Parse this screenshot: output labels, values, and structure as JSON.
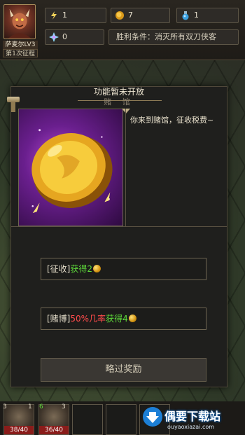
{
  "hero": {
    "name": "萨麦尔LV3",
    "campaign": "第1次征程"
  },
  "resources": {
    "energy": "1",
    "gold": "7",
    "potion": "1",
    "gems": "0"
  },
  "win_condition": "胜利条件：消灭所有双刀侠客",
  "dialog": {
    "notice": "功能暂未开放",
    "title": "赌 馆",
    "description": "你来到赌馆，征收税费~",
    "choice1": {
      "prefix": "[征收]",
      "result": "获得2"
    },
    "choice2": {
      "prefix": "[赌博]",
      "chance": "50%几率",
      "result": "获得4"
    },
    "skip_label": "略过奖励"
  },
  "party": [
    {
      "level": "3",
      "hp": "38/40"
    },
    {
      "level": "1",
      "rank": "6",
      "hp": "36/40"
    },
    {
      "level": "3"
    }
  ],
  "watermark": {
    "title": "偶要下载站",
    "subtitle": "ouyaoxiazai.com"
  },
  "colors": {
    "accent_green": "#5fdc3b",
    "accent_red": "#ff4b4b",
    "gold": "#d49412"
  }
}
